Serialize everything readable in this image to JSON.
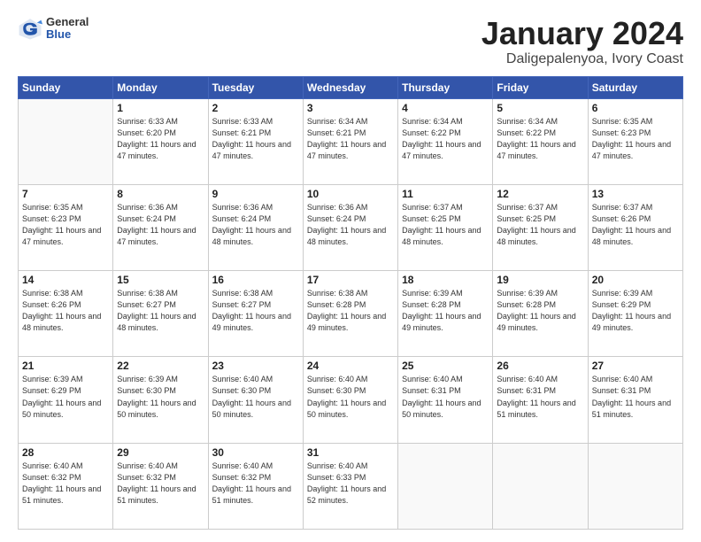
{
  "header": {
    "logo_general": "General",
    "logo_blue": "Blue",
    "month": "January 2024",
    "location": "Daligepalenyoa, Ivory Coast"
  },
  "weekdays": [
    "Sunday",
    "Monday",
    "Tuesday",
    "Wednesday",
    "Thursday",
    "Friday",
    "Saturday"
  ],
  "weeks": [
    [
      {
        "day": "",
        "info": ""
      },
      {
        "day": "1",
        "info": "Sunrise: 6:33 AM\nSunset: 6:20 PM\nDaylight: 11 hours\nand 47 minutes."
      },
      {
        "day": "2",
        "info": "Sunrise: 6:33 AM\nSunset: 6:21 PM\nDaylight: 11 hours\nand 47 minutes."
      },
      {
        "day": "3",
        "info": "Sunrise: 6:34 AM\nSunset: 6:21 PM\nDaylight: 11 hours\nand 47 minutes."
      },
      {
        "day": "4",
        "info": "Sunrise: 6:34 AM\nSunset: 6:22 PM\nDaylight: 11 hours\nand 47 minutes."
      },
      {
        "day": "5",
        "info": "Sunrise: 6:34 AM\nSunset: 6:22 PM\nDaylight: 11 hours\nand 47 minutes."
      },
      {
        "day": "6",
        "info": "Sunrise: 6:35 AM\nSunset: 6:23 PM\nDaylight: 11 hours\nand 47 minutes."
      }
    ],
    [
      {
        "day": "7",
        "info": "Sunrise: 6:35 AM\nSunset: 6:23 PM\nDaylight: 11 hours\nand 47 minutes."
      },
      {
        "day": "8",
        "info": "Sunrise: 6:36 AM\nSunset: 6:24 PM\nDaylight: 11 hours\nand 47 minutes."
      },
      {
        "day": "9",
        "info": "Sunrise: 6:36 AM\nSunset: 6:24 PM\nDaylight: 11 hours\nand 48 minutes."
      },
      {
        "day": "10",
        "info": "Sunrise: 6:36 AM\nSunset: 6:24 PM\nDaylight: 11 hours\nand 48 minutes."
      },
      {
        "day": "11",
        "info": "Sunrise: 6:37 AM\nSunset: 6:25 PM\nDaylight: 11 hours\nand 48 minutes."
      },
      {
        "day": "12",
        "info": "Sunrise: 6:37 AM\nSunset: 6:25 PM\nDaylight: 11 hours\nand 48 minutes."
      },
      {
        "day": "13",
        "info": "Sunrise: 6:37 AM\nSunset: 6:26 PM\nDaylight: 11 hours\nand 48 minutes."
      }
    ],
    [
      {
        "day": "14",
        "info": "Sunrise: 6:38 AM\nSunset: 6:26 PM\nDaylight: 11 hours\nand 48 minutes."
      },
      {
        "day": "15",
        "info": "Sunrise: 6:38 AM\nSunset: 6:27 PM\nDaylight: 11 hours\nand 48 minutes."
      },
      {
        "day": "16",
        "info": "Sunrise: 6:38 AM\nSunset: 6:27 PM\nDaylight: 11 hours\nand 49 minutes."
      },
      {
        "day": "17",
        "info": "Sunrise: 6:38 AM\nSunset: 6:28 PM\nDaylight: 11 hours\nand 49 minutes."
      },
      {
        "day": "18",
        "info": "Sunrise: 6:39 AM\nSunset: 6:28 PM\nDaylight: 11 hours\nand 49 minutes."
      },
      {
        "day": "19",
        "info": "Sunrise: 6:39 AM\nSunset: 6:28 PM\nDaylight: 11 hours\nand 49 minutes."
      },
      {
        "day": "20",
        "info": "Sunrise: 6:39 AM\nSunset: 6:29 PM\nDaylight: 11 hours\nand 49 minutes."
      }
    ],
    [
      {
        "day": "21",
        "info": "Sunrise: 6:39 AM\nSunset: 6:29 PM\nDaylight: 11 hours\nand 50 minutes."
      },
      {
        "day": "22",
        "info": "Sunrise: 6:39 AM\nSunset: 6:30 PM\nDaylight: 11 hours\nand 50 minutes."
      },
      {
        "day": "23",
        "info": "Sunrise: 6:40 AM\nSunset: 6:30 PM\nDaylight: 11 hours\nand 50 minutes."
      },
      {
        "day": "24",
        "info": "Sunrise: 6:40 AM\nSunset: 6:30 PM\nDaylight: 11 hours\nand 50 minutes."
      },
      {
        "day": "25",
        "info": "Sunrise: 6:40 AM\nSunset: 6:31 PM\nDaylight: 11 hours\nand 50 minutes."
      },
      {
        "day": "26",
        "info": "Sunrise: 6:40 AM\nSunset: 6:31 PM\nDaylight: 11 hours\nand 51 minutes."
      },
      {
        "day": "27",
        "info": "Sunrise: 6:40 AM\nSunset: 6:31 PM\nDaylight: 11 hours\nand 51 minutes."
      }
    ],
    [
      {
        "day": "28",
        "info": "Sunrise: 6:40 AM\nSunset: 6:32 PM\nDaylight: 11 hours\nand 51 minutes."
      },
      {
        "day": "29",
        "info": "Sunrise: 6:40 AM\nSunset: 6:32 PM\nDaylight: 11 hours\nand 51 minutes."
      },
      {
        "day": "30",
        "info": "Sunrise: 6:40 AM\nSunset: 6:32 PM\nDaylight: 11 hours\nand 51 minutes."
      },
      {
        "day": "31",
        "info": "Sunrise: 6:40 AM\nSunset: 6:33 PM\nDaylight: 11 hours\nand 52 minutes."
      },
      {
        "day": "",
        "info": ""
      },
      {
        "day": "",
        "info": ""
      },
      {
        "day": "",
        "info": ""
      }
    ]
  ]
}
